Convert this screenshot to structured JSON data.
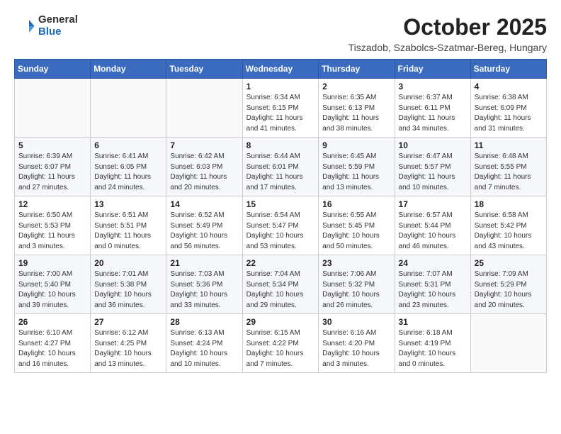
{
  "header": {
    "logo_general": "General",
    "logo_blue": "Blue",
    "month_title": "October 2025",
    "location": "Tiszadob, Szabolcs-Szatmar-Bereg, Hungary"
  },
  "columns": [
    "Sunday",
    "Monday",
    "Tuesday",
    "Wednesday",
    "Thursday",
    "Friday",
    "Saturday"
  ],
  "weeks": [
    [
      {
        "day": "",
        "info": ""
      },
      {
        "day": "",
        "info": ""
      },
      {
        "day": "",
        "info": ""
      },
      {
        "day": "1",
        "info": "Sunrise: 6:34 AM\nSunset: 6:15 PM\nDaylight: 11 hours\nand 41 minutes."
      },
      {
        "day": "2",
        "info": "Sunrise: 6:35 AM\nSunset: 6:13 PM\nDaylight: 11 hours\nand 38 minutes."
      },
      {
        "day": "3",
        "info": "Sunrise: 6:37 AM\nSunset: 6:11 PM\nDaylight: 11 hours\nand 34 minutes."
      },
      {
        "day": "4",
        "info": "Sunrise: 6:38 AM\nSunset: 6:09 PM\nDaylight: 11 hours\nand 31 minutes."
      }
    ],
    [
      {
        "day": "5",
        "info": "Sunrise: 6:39 AM\nSunset: 6:07 PM\nDaylight: 11 hours\nand 27 minutes."
      },
      {
        "day": "6",
        "info": "Sunrise: 6:41 AM\nSunset: 6:05 PM\nDaylight: 11 hours\nand 24 minutes."
      },
      {
        "day": "7",
        "info": "Sunrise: 6:42 AM\nSunset: 6:03 PM\nDaylight: 11 hours\nand 20 minutes."
      },
      {
        "day": "8",
        "info": "Sunrise: 6:44 AM\nSunset: 6:01 PM\nDaylight: 11 hours\nand 17 minutes."
      },
      {
        "day": "9",
        "info": "Sunrise: 6:45 AM\nSunset: 5:59 PM\nDaylight: 11 hours\nand 13 minutes."
      },
      {
        "day": "10",
        "info": "Sunrise: 6:47 AM\nSunset: 5:57 PM\nDaylight: 11 hours\nand 10 minutes."
      },
      {
        "day": "11",
        "info": "Sunrise: 6:48 AM\nSunset: 5:55 PM\nDaylight: 11 hours\nand 7 minutes."
      }
    ],
    [
      {
        "day": "12",
        "info": "Sunrise: 6:50 AM\nSunset: 5:53 PM\nDaylight: 11 hours\nand 3 minutes."
      },
      {
        "day": "13",
        "info": "Sunrise: 6:51 AM\nSunset: 5:51 PM\nDaylight: 11 hours\nand 0 minutes."
      },
      {
        "day": "14",
        "info": "Sunrise: 6:52 AM\nSunset: 5:49 PM\nDaylight: 10 hours\nand 56 minutes."
      },
      {
        "day": "15",
        "info": "Sunrise: 6:54 AM\nSunset: 5:47 PM\nDaylight: 10 hours\nand 53 minutes."
      },
      {
        "day": "16",
        "info": "Sunrise: 6:55 AM\nSunset: 5:45 PM\nDaylight: 10 hours\nand 50 minutes."
      },
      {
        "day": "17",
        "info": "Sunrise: 6:57 AM\nSunset: 5:44 PM\nDaylight: 10 hours\nand 46 minutes."
      },
      {
        "day": "18",
        "info": "Sunrise: 6:58 AM\nSunset: 5:42 PM\nDaylight: 10 hours\nand 43 minutes."
      }
    ],
    [
      {
        "day": "19",
        "info": "Sunrise: 7:00 AM\nSunset: 5:40 PM\nDaylight: 10 hours\nand 39 minutes."
      },
      {
        "day": "20",
        "info": "Sunrise: 7:01 AM\nSunset: 5:38 PM\nDaylight: 10 hours\nand 36 minutes."
      },
      {
        "day": "21",
        "info": "Sunrise: 7:03 AM\nSunset: 5:36 PM\nDaylight: 10 hours\nand 33 minutes."
      },
      {
        "day": "22",
        "info": "Sunrise: 7:04 AM\nSunset: 5:34 PM\nDaylight: 10 hours\nand 29 minutes."
      },
      {
        "day": "23",
        "info": "Sunrise: 7:06 AM\nSunset: 5:32 PM\nDaylight: 10 hours\nand 26 minutes."
      },
      {
        "day": "24",
        "info": "Sunrise: 7:07 AM\nSunset: 5:31 PM\nDaylight: 10 hours\nand 23 minutes."
      },
      {
        "day": "25",
        "info": "Sunrise: 7:09 AM\nSunset: 5:29 PM\nDaylight: 10 hours\nand 20 minutes."
      }
    ],
    [
      {
        "day": "26",
        "info": "Sunrise: 6:10 AM\nSunset: 4:27 PM\nDaylight: 10 hours\nand 16 minutes."
      },
      {
        "day": "27",
        "info": "Sunrise: 6:12 AM\nSunset: 4:25 PM\nDaylight: 10 hours\nand 13 minutes."
      },
      {
        "day": "28",
        "info": "Sunrise: 6:13 AM\nSunset: 4:24 PM\nDaylight: 10 hours\nand 10 minutes."
      },
      {
        "day": "29",
        "info": "Sunrise: 6:15 AM\nSunset: 4:22 PM\nDaylight: 10 hours\nand 7 minutes."
      },
      {
        "day": "30",
        "info": "Sunrise: 6:16 AM\nSunset: 4:20 PM\nDaylight: 10 hours\nand 3 minutes."
      },
      {
        "day": "31",
        "info": "Sunrise: 6:18 AM\nSunset: 4:19 PM\nDaylight: 10 hours\nand 0 minutes."
      },
      {
        "day": "",
        "info": ""
      }
    ]
  ]
}
